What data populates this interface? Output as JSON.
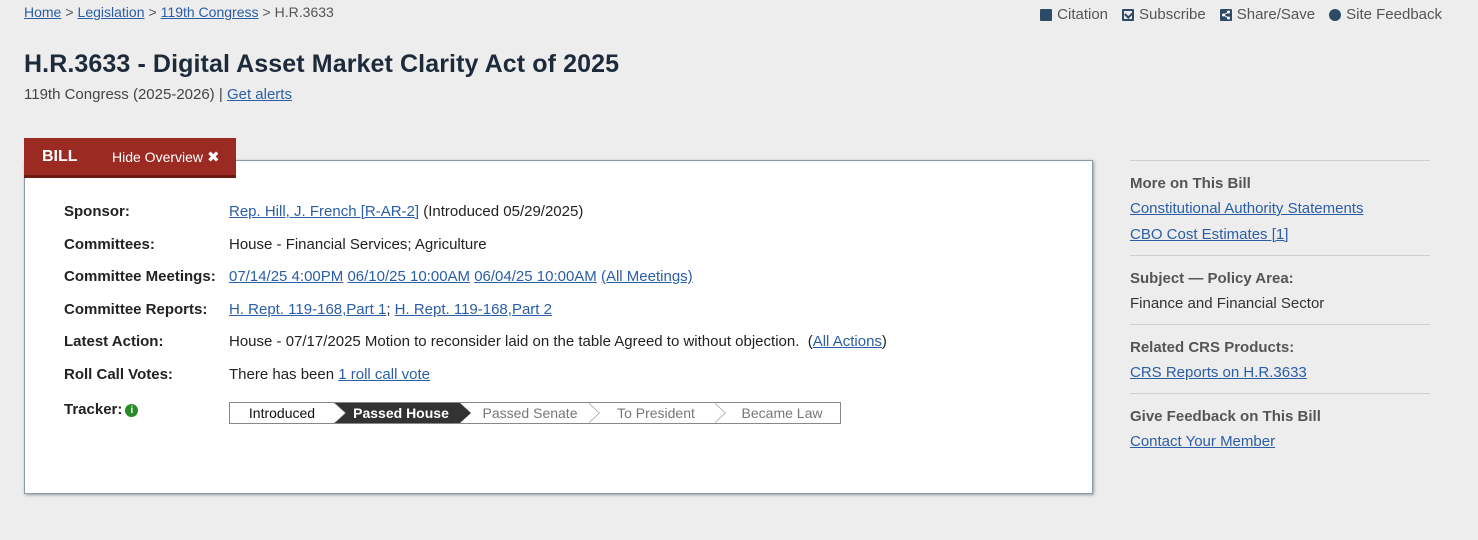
{
  "breadcrumb": {
    "home": "Home",
    "legislation": "Legislation",
    "congress": "119th Congress",
    "current": "H.R.3633",
    "separator": ">"
  },
  "tools": {
    "citation": "Citation",
    "subscribe": "Subscribe",
    "share": "Share/Save",
    "feedback": "Site Feedback"
  },
  "bill": {
    "title": "H.R.3633 - Digital Asset Market Clarity Act of 2025",
    "congress": "119th Congress (2025-2026)",
    "divider": "|",
    "alerts": "Get alerts"
  },
  "tabs": {
    "bill": "BILL",
    "hide_overview": "Hide Overview"
  },
  "overview": {
    "sponsor_label": "Sponsor:",
    "sponsor_link": "Rep. Hill, J. French [R-AR-2]",
    "sponsor_intro": " (Introduced 05/29/2025)",
    "committees_label": "Committees:",
    "committees_value": "House - Financial Services; Agriculture",
    "meetings_label": "Committee Meetings:",
    "meetings": [
      "07/14/25 4:00PM",
      "06/10/25 10:00AM",
      "06/04/25 10:00AM"
    ],
    "all_meetings": "(All Meetings)",
    "reports_label": "Committee Reports:",
    "reports": [
      "H. Rept. 119-168,Part 1",
      "H. Rept. 119-168,Part 2"
    ],
    "reports_sep": ";",
    "latest_label": "Latest Action:",
    "latest_value": "House - 07/17/2025 Motion to reconsider laid on the table Agreed to without objection.",
    "all_actions_open": "(",
    "all_actions": "All Actions",
    "all_actions_close": ")",
    "votes_label": "Roll Call Votes:",
    "votes_prefix": "There has been ",
    "votes_link": "1 roll call vote",
    "tracker_label": "Tracker:",
    "tracker_info": "i"
  },
  "tracker_steps": [
    "Introduced",
    "Passed House",
    "Passed Senate",
    "To President",
    "Became Law"
  ],
  "sidebar": {
    "more_title": "More on This Bill",
    "more_links": [
      "Constitutional Authority Statements",
      "CBO Cost Estimates [1]"
    ],
    "subject_title": "Subject — Policy Area:",
    "subject_value": "Finance and Financial Sector",
    "crs_title": "Related CRS Products:",
    "crs_link": "CRS Reports on H.R.3633",
    "feedback_title": "Give Feedback on This Bill",
    "feedback_link": "Contact Your Member"
  },
  "colors": {
    "tab_red": "#9b2a23",
    "link_blue": "#2b5ea6",
    "tracker_current": "#333333",
    "info_green": "#2a8a2a"
  }
}
